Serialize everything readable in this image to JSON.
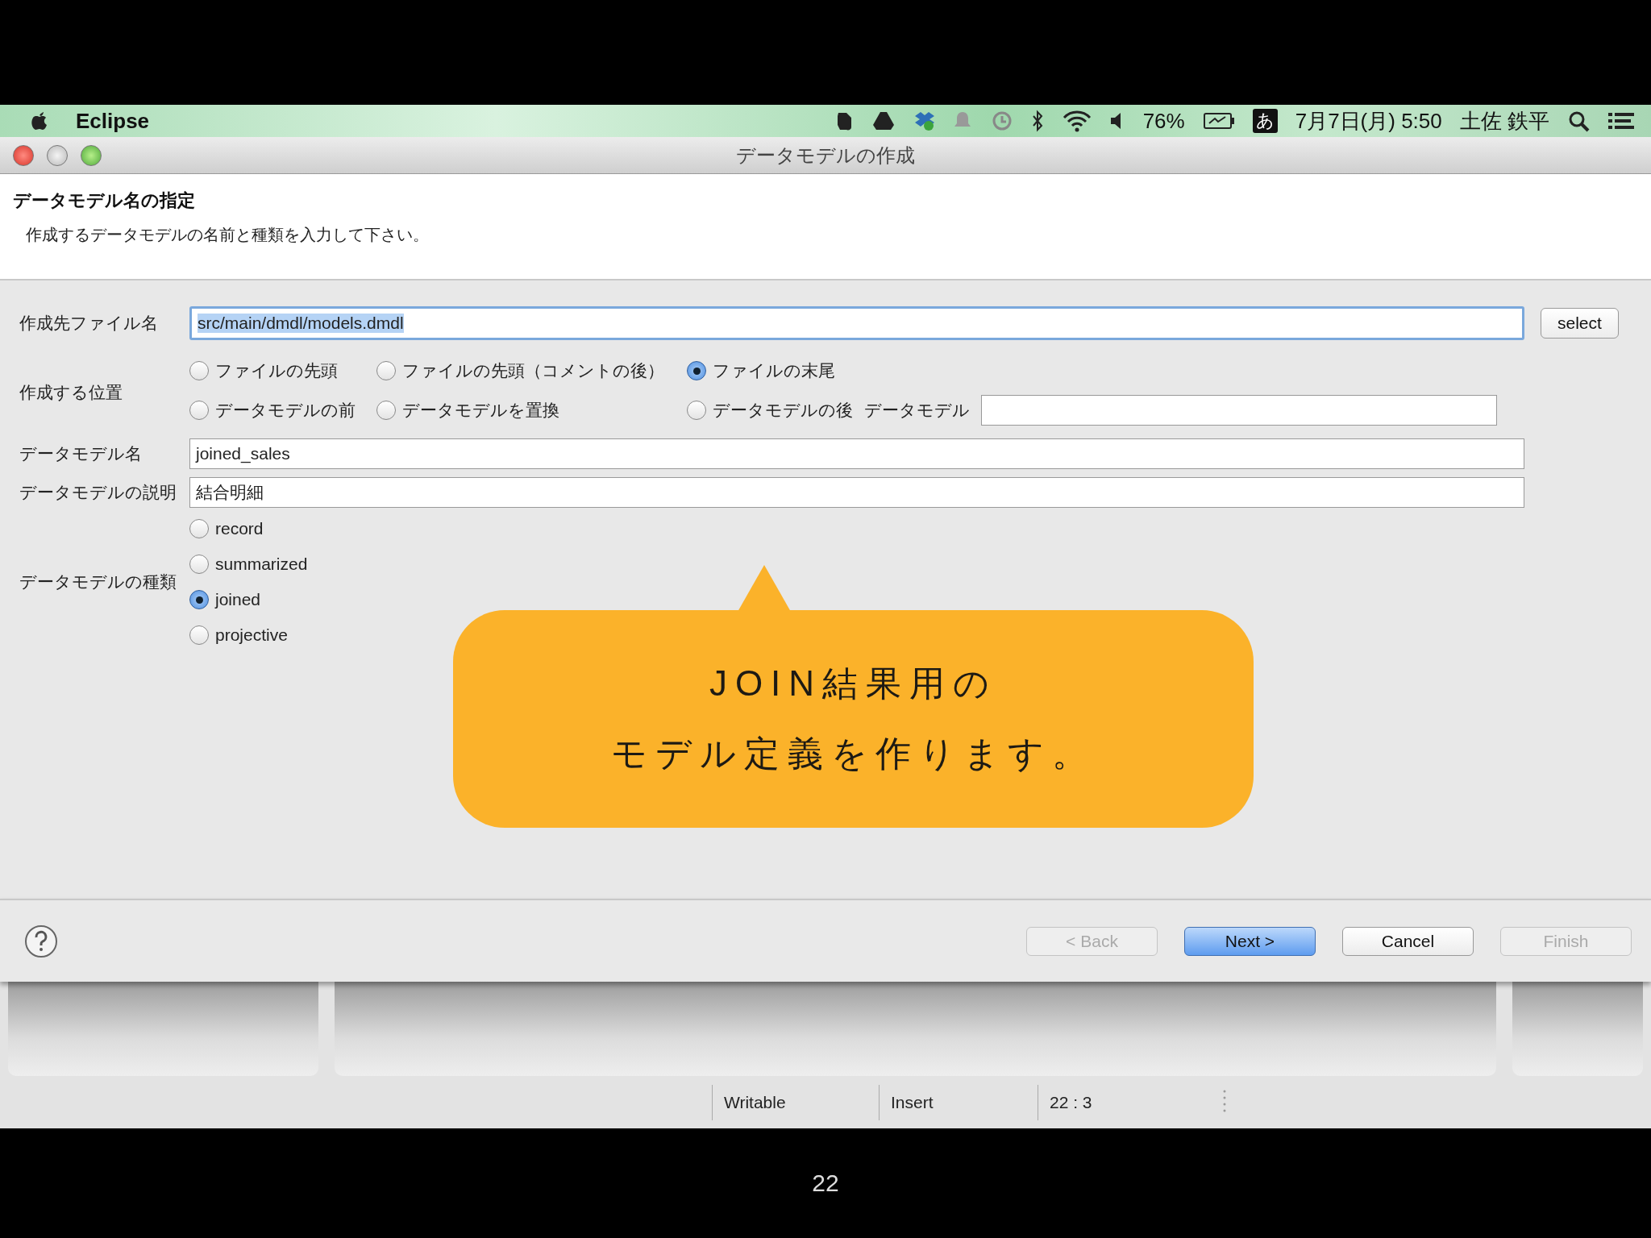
{
  "menu_bar": {
    "app": "Eclipse",
    "battery": "76%",
    "input_method": "あ",
    "datetime": "7月7日(月)  5:50",
    "user": "土佐 鉄平"
  },
  "window": {
    "title": "データモデルの作成"
  },
  "header": {
    "title": "データモデル名の指定",
    "description": "作成するデータモデルの名前と種類を入力して下さい。"
  },
  "form": {
    "file": {
      "label": "作成先ファイル名",
      "value": "src/main/dmdl/models.dmdl",
      "button": "select"
    },
    "position": {
      "label": "作成する位置",
      "model_label": "データモデル",
      "options": [
        {
          "label": "ファイルの先頭",
          "selected": false
        },
        {
          "label": "ファイルの先頭（コメントの後）",
          "selected": false
        },
        {
          "label": "ファイルの末尾",
          "selected": true
        },
        {
          "label": "データモデルの前",
          "selected": false
        },
        {
          "label": "データモデルを置換",
          "selected": false
        },
        {
          "label": "データモデルの後",
          "selected": false
        }
      ]
    },
    "name": {
      "label": "データモデル名",
      "value": "joined_sales"
    },
    "description": {
      "label": "データモデルの説明",
      "value": "結合明細"
    },
    "type": {
      "label": "データモデルの種類",
      "options": [
        {
          "label": "record",
          "selected": false
        },
        {
          "label": "summarized",
          "selected": false
        },
        {
          "label": "joined",
          "selected": true
        },
        {
          "label": "projective",
          "selected": false
        }
      ]
    }
  },
  "callout": {
    "lines": [
      "JOIN結果用の",
      "モデル定義を作ります。"
    ]
  },
  "buttons": [
    {
      "label": "< Back",
      "disabled": true,
      "default": false
    },
    {
      "label": "Next >",
      "disabled": false,
      "default": true
    },
    {
      "label": "Cancel",
      "disabled": false,
      "default": false
    },
    {
      "label": "Finish",
      "disabled": true,
      "default": false
    }
  ],
  "status_bar": [
    "Writable",
    "Insert",
    "22 : 3"
  ],
  "page_number": "22"
}
